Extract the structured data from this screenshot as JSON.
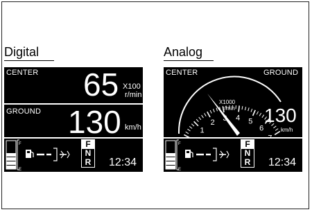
{
  "sections": {
    "digital_title": "Digital",
    "analog_title": "Analog"
  },
  "digital": {
    "center_label": "CENTER",
    "engine_speed": "65",
    "engine_unit_line1": "X100",
    "engine_unit_line2": "r/min",
    "ground_label": "GROUND",
    "ground_speed": "130",
    "ground_unit": "km/h",
    "gears": [
      "F",
      "N",
      "R"
    ],
    "active_gear": "F",
    "clock": "12:34",
    "fuel_full_label": "F",
    "fuel_empty_label": "E"
  },
  "analog": {
    "center_label": "CENTER",
    "ground_label": "GROUND",
    "scale_ticks": [
      "0",
      "1",
      "2",
      "3",
      "4",
      "5",
      "6",
      "7"
    ],
    "scale_unit_line1": "X1000",
    "scale_unit_line2": "r/min",
    "ground_speed": "130",
    "ground_unit": "km/h",
    "gears": [
      "F",
      "N",
      "R"
    ],
    "active_gear": "F",
    "clock": "12:34",
    "fuel_full_label": "F",
    "fuel_empty_label": "E"
  }
}
